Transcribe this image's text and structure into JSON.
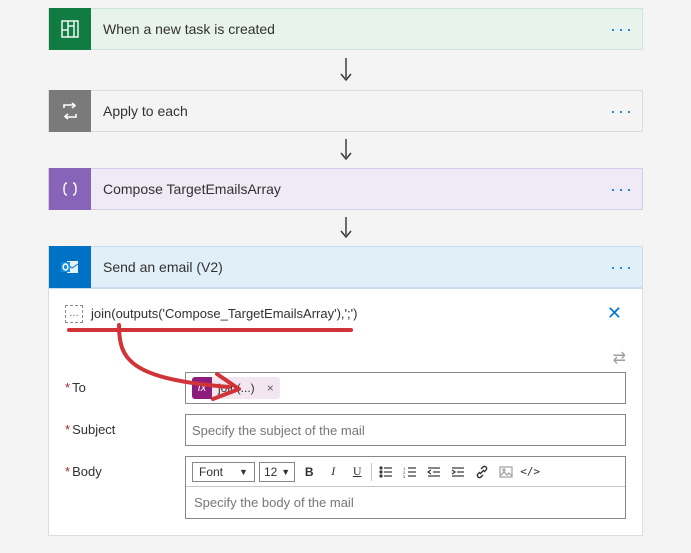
{
  "steps": {
    "trigger": {
      "title": "When a new task is created"
    },
    "apply": {
      "title": "Apply to each"
    },
    "compose": {
      "title": "Compose TargetEmailsArray"
    },
    "email": {
      "title": "Send an email (V2)"
    }
  },
  "peek": {
    "expression": "join(outputs('Compose_TargetEmailsArray'),';')"
  },
  "form": {
    "to_label": "To",
    "subject_label": "Subject",
    "body_label": "Body",
    "token_fx": "fx",
    "token_label": "join(...)",
    "token_x": "×",
    "subject_placeholder": "Specify the subject of the mail",
    "body_placeholder": "Specify the body of the mail"
  },
  "rte": {
    "font_label": "Font",
    "size_label": "12",
    "bold": "B",
    "italic": "I",
    "underline": "U",
    "code": "</>"
  },
  "more": "···"
}
